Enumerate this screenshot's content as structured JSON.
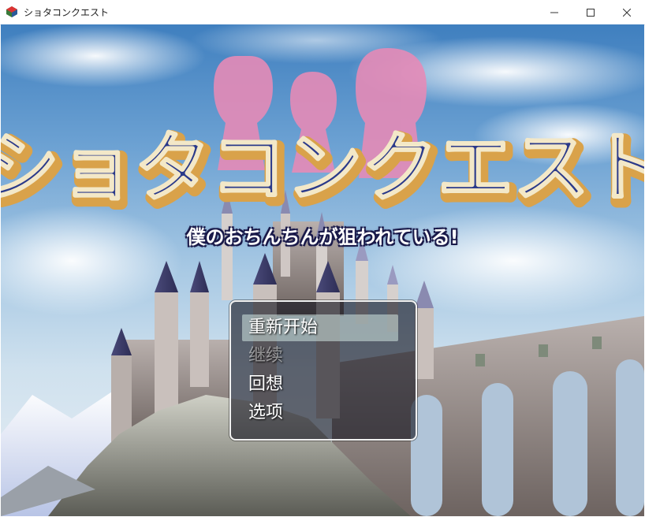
{
  "window": {
    "title": "ショタコンクエスト"
  },
  "game": {
    "logo_text": "ショタコンクエスト",
    "subtitle": "僕のおちんちんが狙われている!"
  },
  "menu": {
    "items": [
      {
        "label": "重新开始",
        "state": "selected"
      },
      {
        "label": "继续",
        "state": "disabled"
      },
      {
        "label": "回想",
        "state": "enabled"
      },
      {
        "label": "选项",
        "state": "enabled"
      }
    ]
  },
  "colors": {
    "logo_fill": "#2b3a8a",
    "logo_edge": "#d9a24a",
    "silhouette": "#e58bb7",
    "sky": "#6da2d3",
    "menu_highlight": "#cfe3dc"
  }
}
